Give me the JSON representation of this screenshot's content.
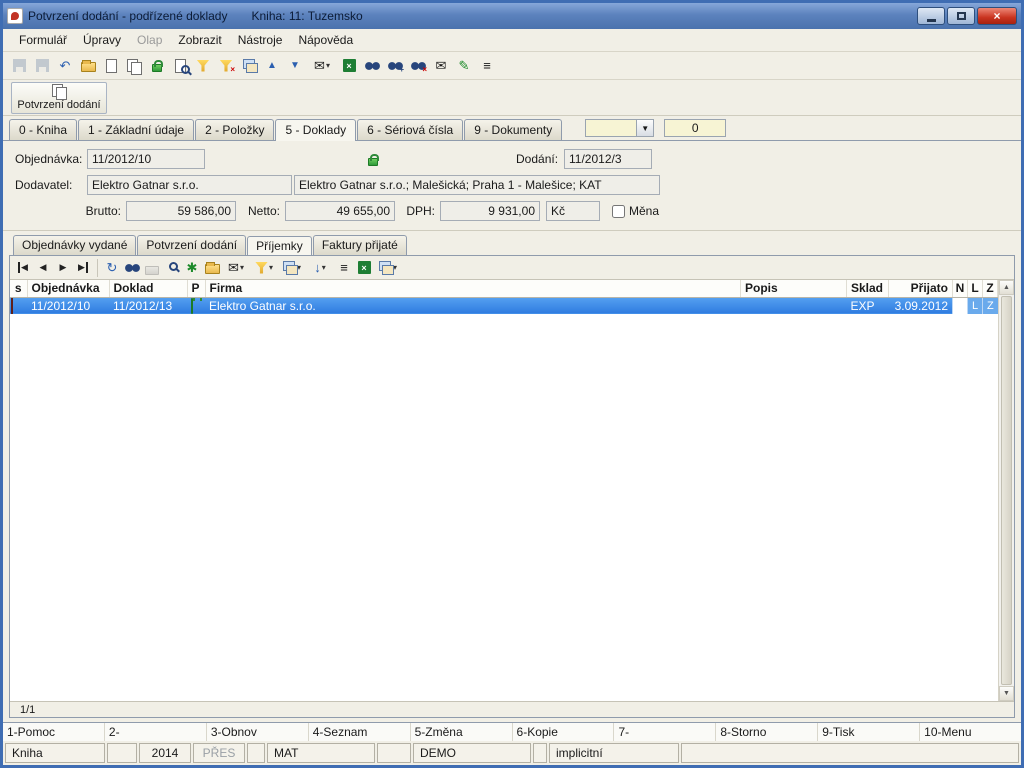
{
  "window": {
    "title": "Potvrzení dodání - podřízené doklady",
    "book": "Kniha: 11: Tuzemsko"
  },
  "menu": {
    "items": [
      "Formulář",
      "Úpravy",
      "Olap",
      "Zobrazit",
      "Nástroje",
      "Nápověda"
    ]
  },
  "toolbar2": {
    "label": "Potvrzení dodání"
  },
  "tabs": {
    "items": [
      "0 - Kniha",
      "1 - Základní údaje",
      "2 - Položky",
      "5 - Doklady",
      "6 - Sériová čísla",
      "9 - Dokumenty"
    ],
    "active": "5 - Doklady",
    "counter": "0"
  },
  "form": {
    "objednavka_label": "Objednávka:",
    "objednavka_value": "11/2012/10",
    "dodani_label": "Dodání:",
    "dodani_value": "11/2012/3",
    "dodavatel_label": "Dodavatel:",
    "dodavatel_value": "Elektro Gatnar s.r.o.",
    "dodavatel_full": "Elektro Gatnar s.r.o.; Malešická; Praha 1 - Malešice; KAT",
    "brutto_label": "Brutto:",
    "brutto_value": "59 586,00",
    "netto_label": "Netto:",
    "netto_value": "49 655,00",
    "dph_label": "DPH:",
    "dph_value": "9 931,00",
    "currency": "Kč",
    "mena_label": "Měna"
  },
  "subtabs": {
    "items": [
      "Objednávky vydané",
      "Potvrzení dodání",
      "Příjemky",
      "Faktury přijaté"
    ],
    "active": "Příjemky"
  },
  "grid": {
    "columns": [
      "s",
      "Objednávka",
      "Doklad",
      "P",
      "Firma",
      "Popis",
      "Sklad",
      "Přijato",
      "N",
      "L",
      "Z"
    ],
    "row": {
      "objednavka": "11/2012/10",
      "doklad": "11/2012/13",
      "firma": "Elektro Gatnar s.r.o.",
      "popis": "",
      "sklad": "EXP",
      "prijato": "3.09.2012",
      "n": "",
      "l": "L",
      "z": "Z"
    },
    "pager": "1/1"
  },
  "fkeys": {
    "items": [
      "1-Pomoc",
      "2-",
      "3-Obnov",
      "4-Seznam",
      "5-Změna",
      "6-Kopie",
      "7-",
      "8-Storno",
      "9-Tisk",
      "10-Menu"
    ]
  },
  "status": {
    "kniha": "Kniha",
    "year": "2014",
    "pres": "PŘES",
    "mat": "MAT",
    "demo": "DEMO",
    "implicit": "implicitní"
  },
  "colors": {
    "titlebar": "#5c82bd",
    "selection": "#2f7ce0",
    "accent_yellow": "#f7f4d4",
    "close_red": "#c9331f"
  },
  "icons": {
    "undo": "↶",
    "arrow_up": "▲",
    "arrow_down": "▼",
    "mail": "✉",
    "pencil": "✎",
    "menu": "≡",
    "refresh": "↻",
    "caret": "▾",
    "prev": "◀",
    "next": "▶",
    "combo_down": "▼",
    "sort": "↓",
    "x": "×",
    "star": "✱",
    "plus": "+"
  }
}
